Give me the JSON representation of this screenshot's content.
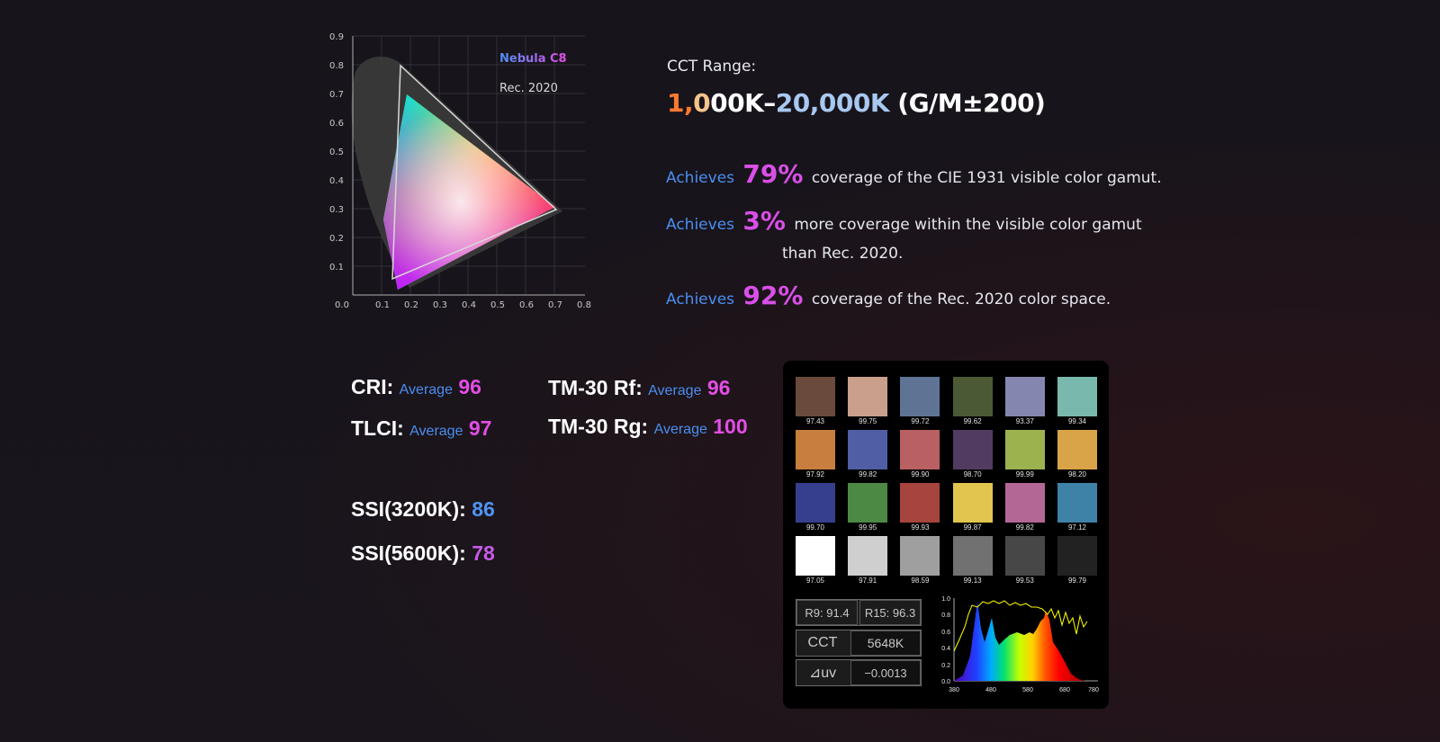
{
  "cie_chart": {
    "legend": {
      "device": "Nebula C8",
      "reference": "Rec. 2020"
    },
    "y_ticks": [
      "0.9",
      "0.8",
      "0.7",
      "0.6",
      "0.5",
      "0.4",
      "0.3",
      "0.2",
      "0.1"
    ],
    "x_ticks": [
      "0.0",
      "0.1",
      "0.2",
      "0.3",
      "0.4",
      "0.5",
      "0.6",
      "0.7",
      "0.8"
    ]
  },
  "cct": {
    "label": "CCT Range:",
    "range_parts": [
      "1,",
      "0",
      "00K–",
      "20,000K",
      " (G/M±200)"
    ]
  },
  "claims": [
    {
      "prefix": "Achieves",
      "value": "79%",
      "text": "coverage of the CIE 1931 visible color gamut."
    },
    {
      "prefix": "Achieves",
      "value": "3%",
      "text": "more coverage within the visible color gamut",
      "text2": "than Rec. 2020."
    },
    {
      "prefix": "Achieves",
      "value": "92%",
      "text": "coverage of the Rec. 2020 color space."
    }
  ],
  "metrics": {
    "cri": {
      "label": "CRI:",
      "avg": "Average",
      "value": "96"
    },
    "tlci": {
      "label": "TLCI:",
      "avg": "Average",
      "value": "97"
    },
    "tm30_rf": {
      "label": "TM-30 Rf:",
      "avg": "Average",
      "value": "96"
    },
    "tm30_rg": {
      "label": "TM-30 Rg:",
      "avg": "Average",
      "value": "100"
    },
    "ssi_3200": {
      "label": "SSI(3200K):",
      "value": "86"
    },
    "ssi_5600": {
      "label": "SSI(5600K):",
      "value": "78"
    }
  },
  "swatches": [
    {
      "color": "#6a4a3c",
      "value": "97.43"
    },
    {
      "color": "#c9a08c",
      "value": "99.75"
    },
    {
      "color": "#5f7495",
      "value": "99.72"
    },
    {
      "color": "#4b5a35",
      "value": "99.62"
    },
    {
      "color": "#8586b0",
      "value": "93.37"
    },
    {
      "color": "#79b9ad",
      "value": "99.34"
    },
    {
      "color": "#c77e3e",
      "value": "97.92"
    },
    {
      "color": "#4f5ea5",
      "value": "99.82"
    },
    {
      "color": "#b96062",
      "value": "99.90"
    },
    {
      "color": "#523b61",
      "value": "98.70"
    },
    {
      "color": "#9cb24f",
      "value": "99.99"
    },
    {
      "color": "#d9a448",
      "value": "98.20"
    },
    {
      "color": "#363f8e",
      "value": "99.70"
    },
    {
      "color": "#4c8944",
      "value": "99.95"
    },
    {
      "color": "#a6443e",
      "value": "99.93"
    },
    {
      "color": "#e1c54e",
      "value": "99.87"
    },
    {
      "color": "#b36795",
      "value": "99.82"
    },
    {
      "color": "#3f82a8",
      "value": "97.12"
    },
    {
      "color": "#ffffff",
      "value": "97.05"
    },
    {
      "color": "#cfcfcf",
      "value": "97.91"
    },
    {
      "color": "#9f9f9f",
      "value": "98.59"
    },
    {
      "color": "#717171",
      "value": "99.13"
    },
    {
      "color": "#474747",
      "value": "99.53"
    },
    {
      "color": "#222222",
      "value": "99.79"
    }
  ],
  "readouts": {
    "r9": "R9: 91.4",
    "r15": "R15: 96.3",
    "cct_label": "CCT",
    "cct_value": "5648K",
    "duv_label": "⊿uv",
    "duv_value": "−0.0013"
  },
  "spectrum": {
    "y_ticks": [
      "1.0",
      "0.8",
      "0.6",
      "0.4",
      "0.2",
      "0.0"
    ],
    "x_ticks": [
      "380",
      "480",
      "580",
      "680",
      "780"
    ]
  },
  "colors": {
    "accent_blue": "#4a8ef0",
    "accent_magenta": "#e44de6",
    "panel_bg": "#000000"
  }
}
